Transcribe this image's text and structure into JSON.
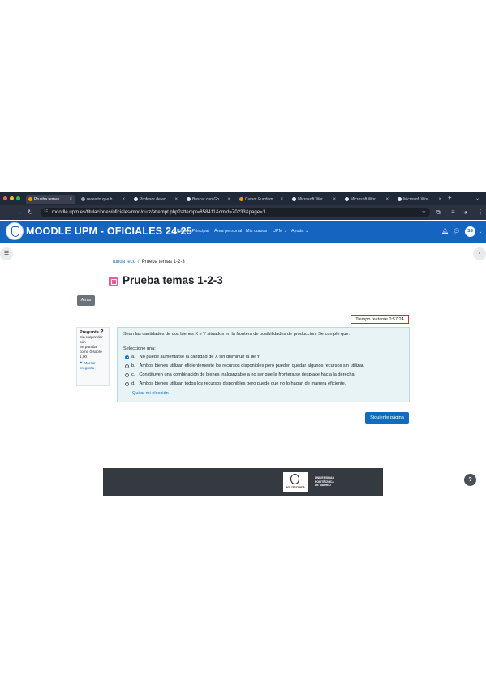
{
  "browser": {
    "tabs": [
      {
        "label": "Prueba temas",
        "active": true,
        "color": "#f29900"
      },
      {
        "label": "recesito que h",
        "active": false,
        "color": "#9aa0a6"
      },
      {
        "label": "Profesor de ec",
        "active": false,
        "color": "#e8eaed"
      },
      {
        "label": "Buscar con Go",
        "active": false,
        "color": "#e8eaed"
      },
      {
        "label": "Curso: Fundam",
        "active": false,
        "color": "#f29900"
      },
      {
        "label": "Microsoft Wor",
        "active": false,
        "color": "#e8eaed"
      },
      {
        "label": "Microsoft Wor",
        "active": false,
        "color": "#e8eaed"
      },
      {
        "label": "Microsoft Wor",
        "active": false,
        "color": "#e8eaed"
      }
    ],
    "new_tab": "+",
    "url": "moodle.upm.es/titulaciones/oficiales/mod/quiz/attempt.php?attempt=858411&cmid=70233&page=1"
  },
  "navbar": {
    "site_name": "MOODLE UPM - OFICIALES 24-25",
    "links": [
      "Página Principal",
      "Área personal",
      "Mis cursos",
      "UPM ⌄",
      "Ayuda ⌄"
    ],
    "avatar": "SS"
  },
  "breadcrumb": {
    "course": "funda_eco",
    "separator": "/",
    "current": "Prueba temas 1-2-3"
  },
  "page_title": "Prueba temas 1-2-3",
  "back_button": "Atrás",
  "timer": "Tiempo restante 0:57:24",
  "question_info": {
    "label": "Pregunta",
    "number": "2",
    "status": "Sin responder aún",
    "score": "Se puntúa como 0 sobre 1,00",
    "flag": "Marcar pregunta"
  },
  "question": {
    "text": "Sean las cantidades de dos bienes X e Y situados en la frontera de posibilidades de producción. Se cumple que:",
    "prompt": "Seleccione una:",
    "answers": [
      {
        "letter": "a.",
        "text": "No puede aumentarse la cantidad de X sin disminuir la de Y.",
        "selected": true
      },
      {
        "letter": "b.",
        "text": "Ambos bienes utilizan eficientemente los recursos disponibles pero pueden quedar algunos recursos sin utilizar.",
        "selected": false
      },
      {
        "letter": "c.",
        "text": "Constituyen una combinación de bienes inalcanzable a no ser que la frontera se desplace hacia la derecha.",
        "selected": false
      },
      {
        "letter": "d.",
        "text": "Ambos bienes utilizan todos los recursos disponibles pero puede que no lo hagan de manera eficiente.",
        "selected": false
      }
    ],
    "clear": "Quitar mi elección"
  },
  "next_button": "Siguiente página",
  "footer": {
    "logo_word": "POLITÉCNICA",
    "text": [
      "UNIVERSIDAD",
      "POLITÉCNICA",
      "DE MADRID"
    ]
  },
  "help": "?"
}
